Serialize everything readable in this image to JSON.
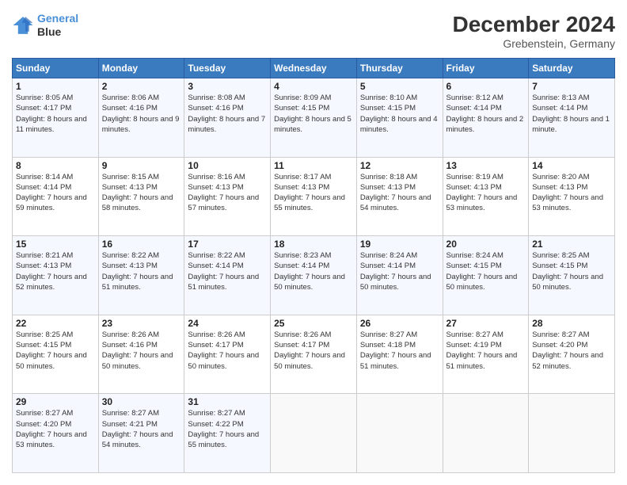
{
  "header": {
    "logo_line1": "General",
    "logo_line2": "Blue",
    "main_title": "December 2024",
    "subtitle": "Grebenstein, Germany"
  },
  "calendar": {
    "days_of_week": [
      "Sunday",
      "Monday",
      "Tuesday",
      "Wednesday",
      "Thursday",
      "Friday",
      "Saturday"
    ],
    "weeks": [
      [
        {
          "day": "1",
          "sunrise": "8:05 AM",
          "sunset": "4:17 PM",
          "daylight": "8 hours and 11 minutes."
        },
        {
          "day": "2",
          "sunrise": "8:06 AM",
          "sunset": "4:16 PM",
          "daylight": "8 hours and 9 minutes."
        },
        {
          "day": "3",
          "sunrise": "8:08 AM",
          "sunset": "4:16 PM",
          "daylight": "8 hours and 7 minutes."
        },
        {
          "day": "4",
          "sunrise": "8:09 AM",
          "sunset": "4:15 PM",
          "daylight": "8 hours and 5 minutes."
        },
        {
          "day": "5",
          "sunrise": "8:10 AM",
          "sunset": "4:15 PM",
          "daylight": "8 hours and 4 minutes."
        },
        {
          "day": "6",
          "sunrise": "8:12 AM",
          "sunset": "4:14 PM",
          "daylight": "8 hours and 2 minutes."
        },
        {
          "day": "7",
          "sunrise": "8:13 AM",
          "sunset": "4:14 PM",
          "daylight": "8 hours and 1 minute."
        }
      ],
      [
        {
          "day": "8",
          "sunrise": "8:14 AM",
          "sunset": "4:14 PM",
          "daylight": "7 hours and 59 minutes."
        },
        {
          "day": "9",
          "sunrise": "8:15 AM",
          "sunset": "4:13 PM",
          "daylight": "7 hours and 58 minutes."
        },
        {
          "day": "10",
          "sunrise": "8:16 AM",
          "sunset": "4:13 PM",
          "daylight": "7 hours and 57 minutes."
        },
        {
          "day": "11",
          "sunrise": "8:17 AM",
          "sunset": "4:13 PM",
          "daylight": "7 hours and 55 minutes."
        },
        {
          "day": "12",
          "sunrise": "8:18 AM",
          "sunset": "4:13 PM",
          "daylight": "7 hours and 54 minutes."
        },
        {
          "day": "13",
          "sunrise": "8:19 AM",
          "sunset": "4:13 PM",
          "daylight": "7 hours and 53 minutes."
        },
        {
          "day": "14",
          "sunrise": "8:20 AM",
          "sunset": "4:13 PM",
          "daylight": "7 hours and 53 minutes."
        }
      ],
      [
        {
          "day": "15",
          "sunrise": "8:21 AM",
          "sunset": "4:13 PM",
          "daylight": "7 hours and 52 minutes."
        },
        {
          "day": "16",
          "sunrise": "8:22 AM",
          "sunset": "4:13 PM",
          "daylight": "7 hours and 51 minutes."
        },
        {
          "day": "17",
          "sunrise": "8:22 AM",
          "sunset": "4:14 PM",
          "daylight": "7 hours and 51 minutes."
        },
        {
          "day": "18",
          "sunrise": "8:23 AM",
          "sunset": "4:14 PM",
          "daylight": "7 hours and 50 minutes."
        },
        {
          "day": "19",
          "sunrise": "8:24 AM",
          "sunset": "4:14 PM",
          "daylight": "7 hours and 50 minutes."
        },
        {
          "day": "20",
          "sunrise": "8:24 AM",
          "sunset": "4:15 PM",
          "daylight": "7 hours and 50 minutes."
        },
        {
          "day": "21",
          "sunrise": "8:25 AM",
          "sunset": "4:15 PM",
          "daylight": "7 hours and 50 minutes."
        }
      ],
      [
        {
          "day": "22",
          "sunrise": "8:25 AM",
          "sunset": "4:15 PM",
          "daylight": "7 hours and 50 minutes."
        },
        {
          "day": "23",
          "sunrise": "8:26 AM",
          "sunset": "4:16 PM",
          "daylight": "7 hours and 50 minutes."
        },
        {
          "day": "24",
          "sunrise": "8:26 AM",
          "sunset": "4:17 PM",
          "daylight": "7 hours and 50 minutes."
        },
        {
          "day": "25",
          "sunrise": "8:26 AM",
          "sunset": "4:17 PM",
          "daylight": "7 hours and 50 minutes."
        },
        {
          "day": "26",
          "sunrise": "8:27 AM",
          "sunset": "4:18 PM",
          "daylight": "7 hours and 51 minutes."
        },
        {
          "day": "27",
          "sunrise": "8:27 AM",
          "sunset": "4:19 PM",
          "daylight": "7 hours and 51 minutes."
        },
        {
          "day": "28",
          "sunrise": "8:27 AM",
          "sunset": "4:20 PM",
          "daylight": "7 hours and 52 minutes."
        }
      ],
      [
        {
          "day": "29",
          "sunrise": "8:27 AM",
          "sunset": "4:20 PM",
          "daylight": "7 hours and 53 minutes."
        },
        {
          "day": "30",
          "sunrise": "8:27 AM",
          "sunset": "4:21 PM",
          "daylight": "7 hours and 54 minutes."
        },
        {
          "day": "31",
          "sunrise": "8:27 AM",
          "sunset": "4:22 PM",
          "daylight": "7 hours and 55 minutes."
        },
        {
          "day": "",
          "sunrise": "",
          "sunset": "",
          "daylight": ""
        },
        {
          "day": "",
          "sunrise": "",
          "sunset": "",
          "daylight": ""
        },
        {
          "day": "",
          "sunrise": "",
          "sunset": "",
          "daylight": ""
        },
        {
          "day": "",
          "sunrise": "",
          "sunset": "",
          "daylight": ""
        }
      ]
    ],
    "labels": {
      "sunrise": "Sunrise: ",
      "sunset": "Sunset: ",
      "daylight": "Daylight: "
    }
  }
}
